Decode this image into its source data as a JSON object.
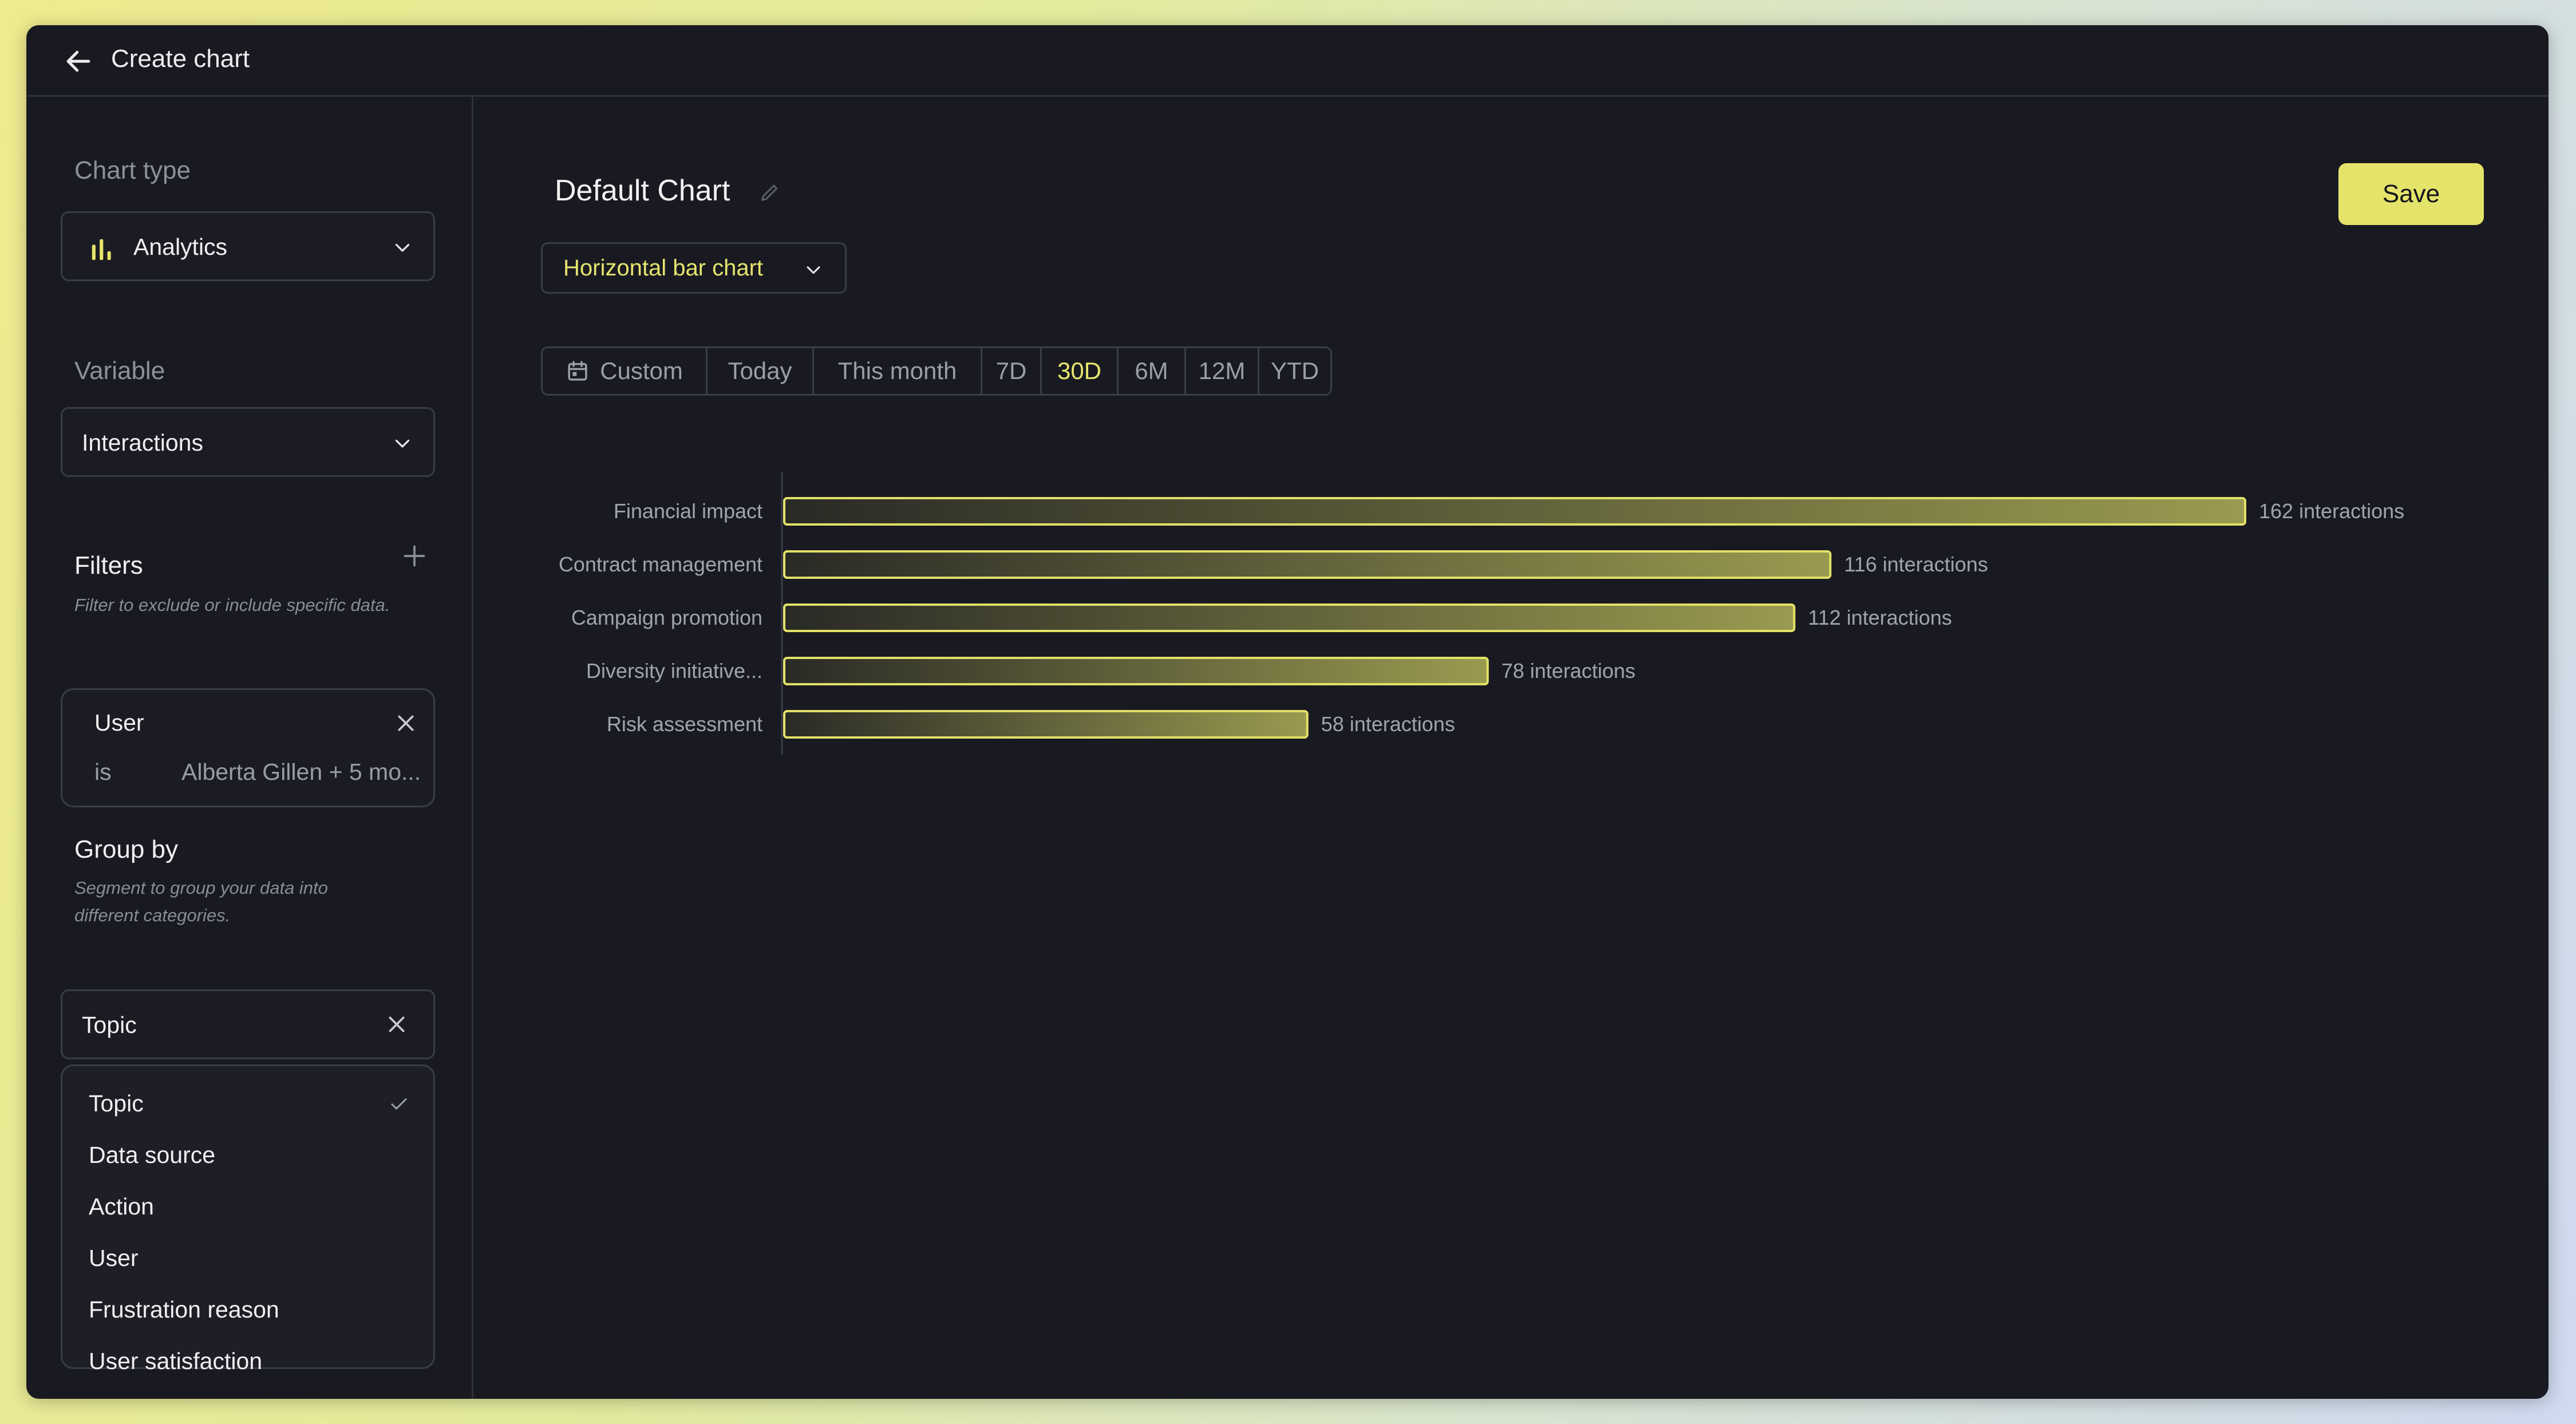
{
  "header": {
    "title": "Create chart"
  },
  "sidebar": {
    "chart_type": {
      "label": "Chart type",
      "value": "Analytics",
      "icon": "bar-chart-icon"
    },
    "variable": {
      "label": "Variable",
      "value": "Interactions"
    },
    "filters": {
      "title": "Filters",
      "hint": "Filter to exclude or include specific data.",
      "items": [
        {
          "field": "User",
          "operator": "is",
          "value": "Alberta Gillen + 5 mo..."
        }
      ]
    },
    "group_by": {
      "title": "Group by",
      "hint_line1": "Segment to group your data into",
      "hint_line2": "different categories.",
      "value": "Topic",
      "options": [
        "Topic",
        "Data source",
        "Action",
        "User",
        "Frustration reason",
        "User satisfaction"
      ],
      "selected": "Topic"
    }
  },
  "main": {
    "chart_title": "Default Chart",
    "save_label": "Save",
    "chart_type_label": "Horizontal bar chart",
    "ranges": [
      "Custom",
      "Today",
      "This month",
      "7D",
      "30D",
      "6M",
      "12M",
      "YTD"
    ],
    "active_range": "30D"
  },
  "colors": {
    "accent": "#e5e46a",
    "background": "#191a21",
    "bar_stroke": "#e2e068",
    "bar_fill_start": "#2a2a26",
    "bar_fill_end": "#9a9a50"
  },
  "chart_data": {
    "type": "bar",
    "orientation": "horizontal",
    "categories": [
      "Financial impact",
      "Contract management",
      "Campaign promotion",
      "Diversity initiative...",
      "Risk assessment"
    ],
    "values": [
      162,
      116,
      112,
      78,
      58
    ],
    "value_labels": [
      "162 interactions",
      "116 interactions",
      "112 interactions",
      "78 interactions",
      "58 interactions"
    ],
    "xlim": [
      0,
      162
    ],
    "grid": false,
    "legend": "none"
  }
}
